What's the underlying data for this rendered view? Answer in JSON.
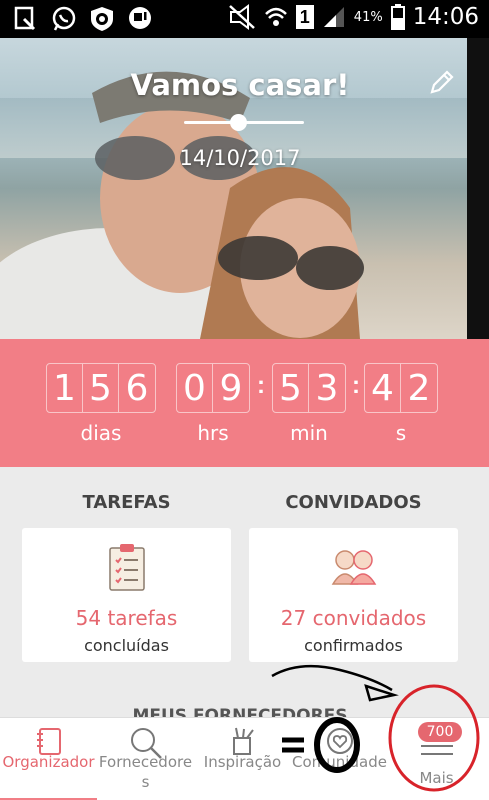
{
  "status_bar": {
    "time": "14:06",
    "battery_pct": "41%",
    "sim": "1"
  },
  "hero": {
    "title": "Vamos casar!",
    "date": "14/10/2017"
  },
  "countdown": {
    "days": [
      "1",
      "5",
      "6"
    ],
    "days_label": "dias",
    "hours": [
      "0",
      "9"
    ],
    "hours_label": "hrs",
    "minutes": [
      "5",
      "3"
    ],
    "minutes_label": "min",
    "seconds": [
      "4",
      "2"
    ],
    "seconds_label": "s"
  },
  "tasks": {
    "heading": "TAREFAS",
    "count": "54 tarefas",
    "sub": "concluídas"
  },
  "guests": {
    "heading": "CONVIDADOS",
    "count": "27 convidados",
    "sub": "confirmados"
  },
  "peek_heading": "MEUS FORNECEDORES",
  "bottom_nav": {
    "items": [
      {
        "label": "Organizador",
        "icon": "notebook-icon"
      },
      {
        "label": "Fornecedores",
        "icon": "search-icon"
      },
      {
        "label": "Inspiração",
        "icon": "brush-cup-icon"
      },
      {
        "label": "Comunidade",
        "icon": "heart-chat-icon"
      },
      {
        "label": "Mais",
        "icon": "menu-icon"
      }
    ],
    "badge": "700"
  },
  "colors": {
    "accent": "#f27e86",
    "accent_text": "#e5676f",
    "annotation_red": "#d8232a"
  }
}
